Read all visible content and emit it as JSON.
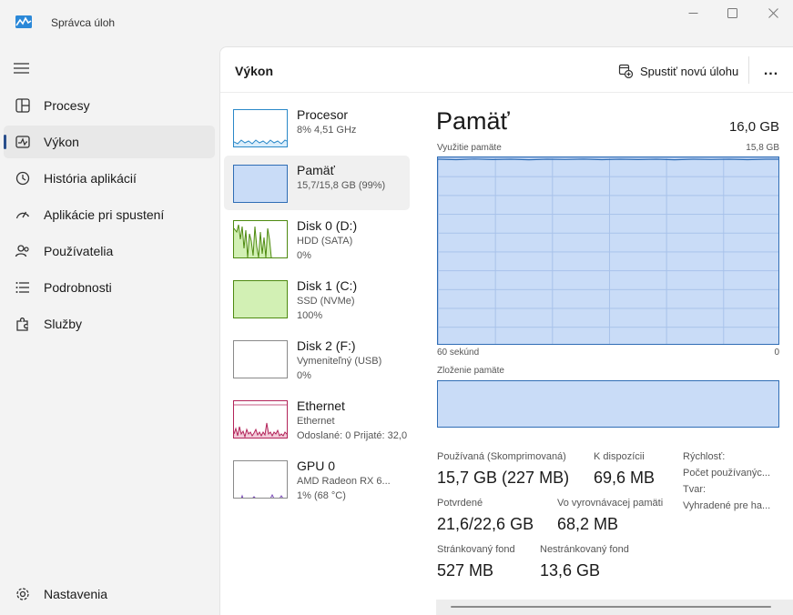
{
  "window": {
    "title": "Správca úloh"
  },
  "sidebar": {
    "items": [
      {
        "label": "Procesy",
        "icon": "grid-icon"
      },
      {
        "label": "Výkon",
        "icon": "performance-icon"
      },
      {
        "label": "História aplikácií",
        "icon": "history-icon"
      },
      {
        "label": "Aplikácie pri spustení",
        "icon": "speedometer-icon"
      },
      {
        "label": "Používatelia",
        "icon": "users-icon"
      },
      {
        "label": "Podrobnosti",
        "icon": "list-icon"
      },
      {
        "label": "Služby",
        "icon": "puzzle-icon"
      }
    ],
    "settings_label": "Nastavenia",
    "active_index": 1
  },
  "header": {
    "title": "Výkon",
    "run_task_label": "Spustiť novú úlohu",
    "more_label": "..."
  },
  "devices": [
    {
      "name": "Procesor",
      "line1": "8%  4,51 GHz",
      "line2": ""
    },
    {
      "name": "Pamäť",
      "line1": "15,7/15,8 GB (99%)",
      "line2": ""
    },
    {
      "name": "Disk 0 (D:)",
      "line1": "HDD (SATA)",
      "line2": "0%"
    },
    {
      "name": "Disk 1 (C:)",
      "line1": "SSD (NVMe)",
      "line2": "100%"
    },
    {
      "name": "Disk 2 (F:)",
      "line1": "Vymeniteľný (USB)",
      "line2": "0%"
    },
    {
      "name": "Ethernet",
      "line1": "Ethernet",
      "line2": "Odoslané: 0 Prijaté: 32,0"
    },
    {
      "name": "GPU 0",
      "line1": "AMD Radeon RX 6...",
      "line2": "1%  (68 °C)"
    }
  ],
  "detail": {
    "title": "Pamäť",
    "total": "16,0 GB",
    "usage_label": "Využitie pamäte",
    "usage_max": "15,8 GB",
    "time_left": "60 sekúnd",
    "time_right": "0",
    "composition_label": "Zloženie pamäte",
    "stats": {
      "in_use_label": "Používaná (Skomprimovaná)",
      "in_use_value": "15,7 GB (227 MB)",
      "available_label": "K dispozícii",
      "available_value": "69,6 MB",
      "committed_label": "Potvrdené",
      "committed_value": "21,6/22,6 GB",
      "cached_label": "Vo vyrovnávacej pamäti",
      "cached_value": "68,2 MB",
      "paged_label": "Stránkovaný fond",
      "paged_value": "527 MB",
      "nonpaged_label": "Nestránkovaný fond",
      "nonpaged_value": "13,6 GB"
    },
    "side": {
      "speed_label": "Rýchlosť:",
      "slots_label": "Počet používanýc...",
      "form_label": "Tvar:",
      "reserved_label": "Vyhradené pre ha..."
    }
  },
  "colors": {
    "accent": "#2a4f8c",
    "memory_fill": "#c9dcf7",
    "memory_border": "#2f6db5",
    "disk_fill": "#d2f0b4",
    "disk_line": "#4e8a10",
    "cpu_line": "#2a88c8",
    "ethernet_line": "#b3245a",
    "gpu_line": "#7a4ab8"
  }
}
